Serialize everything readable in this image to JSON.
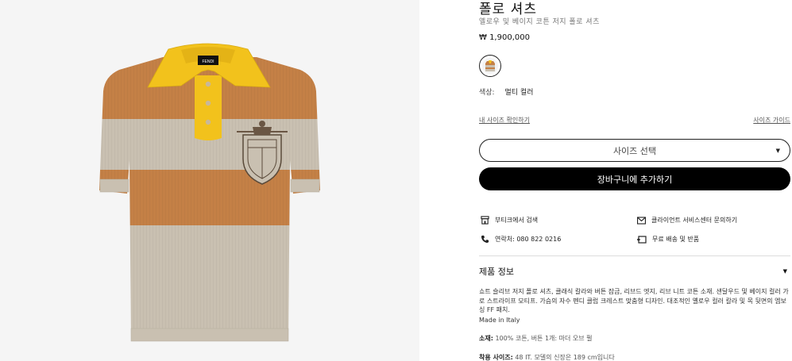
{
  "product": {
    "title": "폴로 셔츠",
    "subtitle": "옐로우 및 베이지 코튼 저지 폴로 셔츠",
    "price": "₩ 1,900,000"
  },
  "color": {
    "label": "색상:",
    "value": "멀티 컬러"
  },
  "size": {
    "my_size_link": "내 사이즈 확인하기",
    "size_guide_link": "사이즈 가이드",
    "select_placeholder": "사이즈 선택"
  },
  "cart": {
    "add_label": "장바구니에 추가하기"
  },
  "services": {
    "boutique_search": "부티크에서 검색",
    "client_service": "클라이언트 서비스센터 문의하기",
    "contact": "연락처: 080 822 0216",
    "free_shipping": "무료 배송 및 반품"
  },
  "info": {
    "heading": "제품 정보",
    "description": "쇼트 슬리브 저지 폴로 셔츠, 클래식 칼라와 버튼 잠금, 리브드 엣지, 리브 니트 코튼 소재. 샌달우드 및 베이지 컬러 가로 스트라이프 모티프. 가슴의 자수 펜디 클럽 크레스트 맞춤형 디자인. 대조적인 옐로우 컬러 칼라 및 목 뒷면의 엠보싱 FF 패치.",
    "made_in": "Made in Italy",
    "material_label": "소재:",
    "material_value": "100% 코튼, 버튼 1개: 마더 오브 펄",
    "fit_label": "착용 사이즈:",
    "fit_value": "48 IT. 모델의 신장은 189 cm입니다"
  },
  "colors": {
    "orange_stripe": "#c48046",
    "beige_stripe": "#c9c0b1",
    "collar_yellow": "#f2c21c",
    "button_black": "#000000"
  },
  "brand_label": "FENDI"
}
